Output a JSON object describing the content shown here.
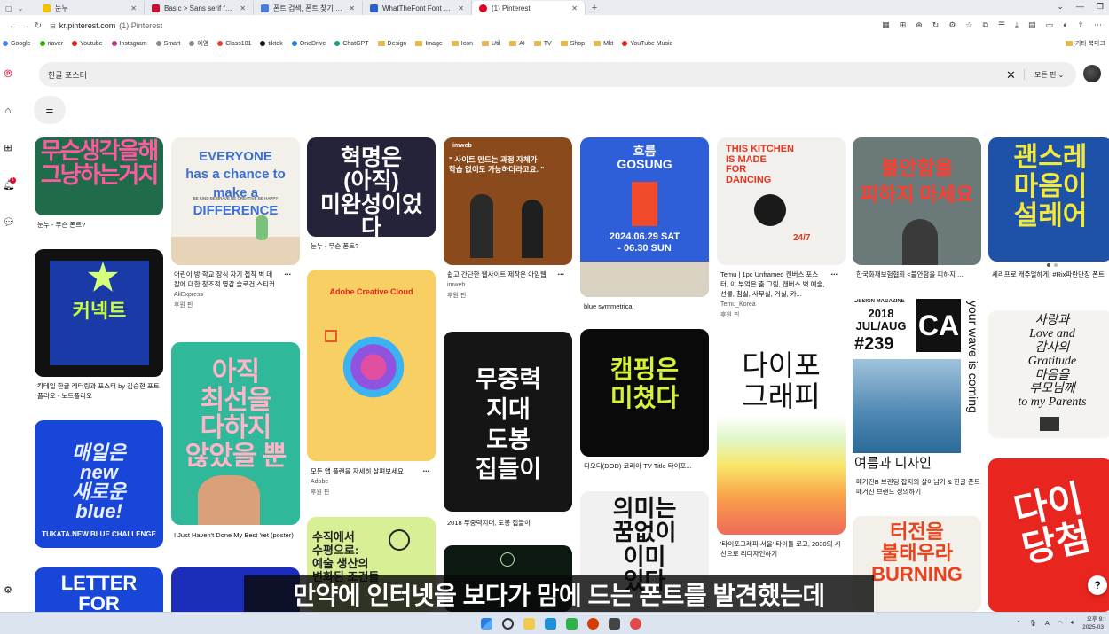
{
  "browser": {
    "tabs": [
      {
        "title": "눈누",
        "color": "#f2c200"
      },
      {
        "title": "Basic > Sans serif fonts | dafc",
        "color": "#c8102e"
      },
      {
        "title": "폰트 검색, 폰트 찾기 - 폰트폰",
        "color": "#4a7bd9"
      },
      {
        "title": "WhatTheFont Font Finder - Id",
        "color": "#2c5fd4"
      },
      {
        "title": "(1) Pinterest",
        "color": "#e60023"
      }
    ],
    "url_domain": "kr.pinterest.com",
    "url_title": "(1) Pinterest",
    "bookmarks": [
      "Google",
      "naver",
      "Youtube",
      "Instagram",
      "Smart",
      "예염",
      "Class101",
      "tiktok",
      "OneDrive",
      "ChatGPT",
      "Design",
      "Image",
      "Icon",
      "Util",
      "AI",
      "TV",
      "Shop",
      "Mkt",
      "YouTube Music"
    ],
    "bookmarks_other": "기타 북마크"
  },
  "search": {
    "query": "한글 포스터",
    "scope": "모든 핀"
  },
  "pins": {
    "p1": {
      "art": "무슨생각을해\n그냥하는거지",
      "title": "눈누 - 무슨 폰트?"
    },
    "p2": {
      "art": "EVERYONE\nhas a chance to make a\nDIFFERENCE",
      "small": "BE KIND  BE BRAVE  BE CREATIVE  BE HAPPY",
      "title": "어린이 방 학교 장식 자기 접착 벽 데칼에 대한 창조적 영감 슬로건 스티커",
      "sub": "AliExpress",
      "sub2": "후원 핀"
    },
    "p3": {
      "art": "혁명은\n(아직)\n미완성이었다",
      "title": "눈누 - 무슨 폰트?"
    },
    "p4": {
      "brand": "imweb",
      "art": "\" 사이트 만드는 과정 자체가\n학습 없이도 가능하더라고요. \"",
      "title": "쉽고 간단한 웹사이트 제작은 아임웹",
      "sub": "imweb",
      "sub2": "후원 핀"
    },
    "p5": {
      "art": "흐름\nGOSUNG",
      "date": "2024.06.29 SAT\n- 06.30 SUN",
      "title": "blue symmetrical"
    },
    "p6": {
      "art": "THIS KITCHEN\nIS MADE\nFOR\nDANCING",
      "num": "24/7",
      "title": "Temu | 1pc Unframed 캔버스 포스터, 이 부엌은 춤 그림, 캔버스 벽 예술, 선물, 침실, 사무실, 거실, 카...",
      "sub": "Temu_Korea",
      "sub2": "후원 핀"
    },
    "p7": {
      "art": "불안함을\n피하지 마세요",
      "title": "한국화재보험협회 <불안함을 피하지 ..."
    },
    "p8": {
      "art": "괜스레\n마음이\n설레어",
      "title": "세리프로 캐주얼하게, #Rix파란만장 폰트"
    },
    "p9": {
      "art": "커넥트",
      "title": "칵테일 한글 레터링과 포스터 by 김승현 포트폴리오 - 노트폴리오"
    },
    "p10": {
      "art": "아직\n최선을\n다하지\n않았을 뿐",
      "title": "I Just Haven't Done My Best Yet (poster)"
    },
    "p11": {
      "brand": "Adobe Creative Cloud",
      "title": "모든 앱 플랜을 자세히 살펴보세요",
      "sub": "Adobe",
      "sub2": "후원 핀"
    },
    "p12": {
      "art": "무중력\n지대\n도봉\n집들이",
      "title": "2018 무중력지대, 도봉 집들이"
    },
    "p13": {
      "art": "캠핑은\n미쳤다",
      "title": "디오디(DOD) 코리아 TV Title 타이포..."
    },
    "p14": {
      "art": "다이포\n그래피",
      "title": "'타이포그래피 서울' 타이틀 로고, 2030의 시선으로 리디자인하기"
    },
    "p15": {
      "header": "DESIGN MAGAZINE",
      "year": "2018\nJUL/AUG",
      "num": "#239",
      "logo": "CA",
      "side": "your wave is coming",
      "art": "여름과 디자인",
      "title": "매거진B 브랜딩 잡지의 살아남기 & 한글 폰트 매거진 브랜드 정의하기"
    },
    "p16": {
      "art": "사랑과\nLove and\n감사의\nGratitude\n마음을\n부모님께\nto my Parents"
    },
    "p17": {
      "art": "매일은\nnew\n새로운\nblue!",
      "title": "TUKATA.NEW BLUE CHALLENGE"
    },
    "p18": {
      "art": "수직에서\n수평으로:\n예술 생산의\n변화된 조건들"
    },
    "p19": {
      "art": "의미는\n꿈없이\n이미\n있다"
    },
    "p20": {
      "art": "터전을\n불태우라\nBURNING"
    },
    "p21": {
      "art": "LETTER\nFOR"
    },
    "p22": {
      "art": "다이\n당첨"
    }
  },
  "subtitle": "만약에 인터넷을 보다가 맘에 드는 폰트를 발견했는데",
  "taskbar": {
    "time": "오후 9:",
    "date": "2025-03"
  }
}
